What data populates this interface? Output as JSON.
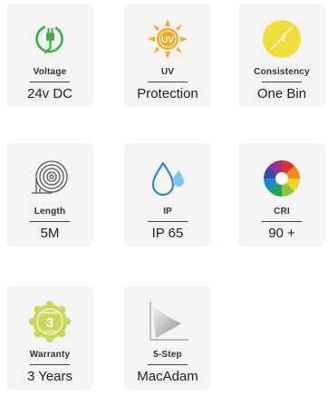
{
  "specs": [
    {
      "label": "Voltage",
      "value": "24v DC",
      "icon": "power-plug-icon"
    },
    {
      "label": "UV",
      "value": "Protection",
      "icon": "uv-sun-icon",
      "badge": "UV"
    },
    {
      "label": "Consistency",
      "value": "One Bin",
      "icon": "consistency-icon"
    },
    {
      "label": "Length",
      "value": "5M",
      "icon": "reel-icon"
    },
    {
      "label": "IP",
      "value": "IP 65",
      "icon": "water-drops-icon"
    },
    {
      "label": "CRI",
      "value": "90 +",
      "icon": "color-wheel-icon"
    },
    {
      "label": "Warranty",
      "value": "3 Years",
      "icon": "warranty-badge-icon",
      "badge_top": "WARRANTY",
      "badge_number": "3",
      "badge_bottom": "YEARS"
    },
    {
      "label": "5-Step",
      "value": "MacAdam",
      "icon": "macadam-chart-icon"
    }
  ],
  "colors": {
    "green": "#3fae49",
    "orange": "#f7a823",
    "yellow": "#f0dd3a",
    "blue": "#2e87c9",
    "card_bg": "#f4f4f4"
  }
}
